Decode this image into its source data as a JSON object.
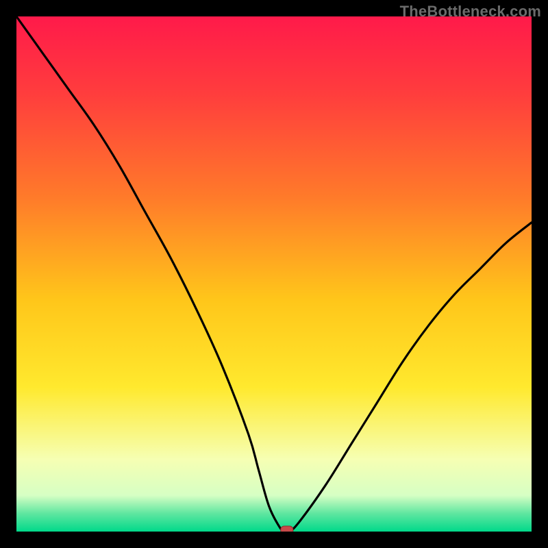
{
  "watermark": "TheBottleneck.com",
  "colors": {
    "frame": "#000000",
    "watermark": "#6b6b6b",
    "curve": "#000000",
    "marker_fill": "#c84a4a",
    "marker_stroke": "#8f2f2f",
    "gradient_stops": [
      {
        "offset": 0.0,
        "color": "#ff1a4a"
      },
      {
        "offset": 0.15,
        "color": "#ff3d3d"
      },
      {
        "offset": 0.35,
        "color": "#ff7a2a"
      },
      {
        "offset": 0.55,
        "color": "#ffc61a"
      },
      {
        "offset": 0.72,
        "color": "#ffe92e"
      },
      {
        "offset": 0.86,
        "color": "#f6ffb3"
      },
      {
        "offset": 0.93,
        "color": "#d6ffc4"
      },
      {
        "offset": 0.965,
        "color": "#5fe6a0"
      },
      {
        "offset": 1.0,
        "color": "#00d98a"
      }
    ]
  },
  "chart_data": {
    "type": "line",
    "title": "",
    "xlabel": "",
    "ylabel": "",
    "xlim": [
      0,
      100
    ],
    "ylim": [
      0,
      100
    ],
    "grid": false,
    "legend": null,
    "annotations": [],
    "series": [
      {
        "name": "bottleneck-curve",
        "x": [
          0,
          5,
          10,
          15,
          20,
          25,
          30,
          35,
          40,
          45,
          47,
          49,
          51,
          52,
          53,
          55,
          60,
          65,
          70,
          75,
          80,
          85,
          90,
          95,
          100
        ],
        "y": [
          100,
          93,
          86,
          79,
          71,
          62,
          53,
          43,
          32,
          19,
          12,
          5,
          1,
          0,
          0,
          2,
          9,
          17,
          25,
          33,
          40,
          46,
          51,
          56,
          60
        ]
      }
    ],
    "marker": {
      "x": 52.5,
      "y": 0,
      "shape": "rounded-rect",
      "color": "#c84a4a"
    }
  }
}
